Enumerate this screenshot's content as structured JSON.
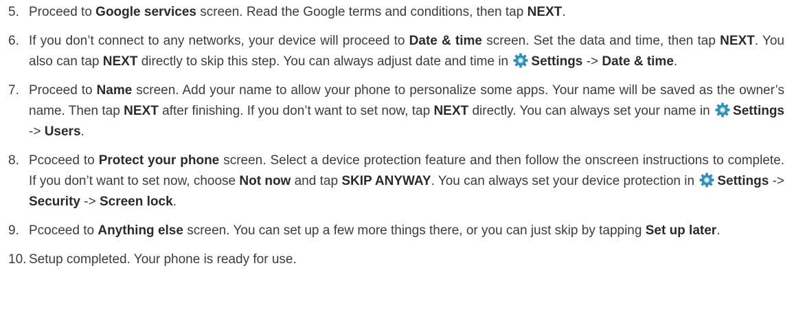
{
  "steps": [
    {
      "number": "5.",
      "parts": [
        {
          "t": "Proceed to "
        },
        {
          "t": "Google services",
          "b": true
        },
        {
          "t": " screen. Read the Google terms and conditions, then tap "
        },
        {
          "t": "NEXT",
          "b": true
        },
        {
          "t": "."
        }
      ]
    },
    {
      "number": "6.",
      "parts": [
        {
          "t": "If you don’t connect to any networks, your device will proceed to "
        },
        {
          "t": "Date & time",
          "b": true
        },
        {
          "t": " screen. Set the data and time, then tap "
        },
        {
          "t": "NEXT",
          "b": true
        },
        {
          "t": ". You also can tap "
        },
        {
          "t": "NEXT",
          "b": true
        },
        {
          "t": " directly to skip this step. You can always adjust date and time in "
        },
        {
          "icon": "settings-gear-icon"
        },
        {
          "t": "Settings",
          "b": true
        },
        {
          "t": " -> "
        },
        {
          "t": "Date & time",
          "b": true
        },
        {
          "t": "."
        }
      ]
    },
    {
      "number": "7.",
      "parts": [
        {
          "t": "Proceed to "
        },
        {
          "t": "Name",
          "b": true
        },
        {
          "t": " screen. Add your name to allow your phone to personalize some apps. Your name will be saved as the owner’s name. Then tap "
        },
        {
          "t": "NEXT",
          "b": true
        },
        {
          "t": " after finishing. If you don’t want to set now, tap "
        },
        {
          "t": "NEXT",
          "b": true
        },
        {
          "t": " directly. You can always set your name in "
        },
        {
          "icon": "settings-gear-icon"
        },
        {
          "t": "Settings",
          "b": true
        },
        {
          "t": " -> "
        },
        {
          "t": "Users",
          "b": true
        },
        {
          "t": "."
        }
      ]
    },
    {
      "number": "8.",
      "parts": [
        {
          "t": "Pcoceed to "
        },
        {
          "t": "Protect your phone",
          "b": true
        },
        {
          "t": " screen. Select a device protection feature and then follow the onscreen instructions to complete. If you don’t want to set now, choose "
        },
        {
          "t": "Not now",
          "b": true
        },
        {
          "t": " and tap "
        },
        {
          "t": "SKIP ANYWAY",
          "b": true
        },
        {
          "t": ". You can always set your device protection in "
        },
        {
          "icon": "settings-gear-icon"
        },
        {
          "t": "Settings",
          "b": true
        },
        {
          "t": " -> "
        },
        {
          "t": "Security",
          "b": true
        },
        {
          "t": " -> "
        },
        {
          "t": "Screen lock",
          "b": true
        },
        {
          "t": "."
        }
      ]
    },
    {
      "number": "9.",
      "parts": [
        {
          "t": "Pcoceed to "
        },
        {
          "t": "Anything else",
          "b": true
        },
        {
          "t": " screen. You can set up a few more things there, or you can just skip by tapping "
        },
        {
          "t": "Set up later",
          "b": true
        },
        {
          "t": "."
        }
      ]
    },
    {
      "number": "10.",
      "parts": [
        {
          "t": "Setup completed. Your phone is ready for use."
        }
      ]
    }
  ],
  "colors": {
    "text": "#3c3c3c",
    "icon_primary": "#2f8fb8",
    "icon_light": "#9fd3e8"
  }
}
